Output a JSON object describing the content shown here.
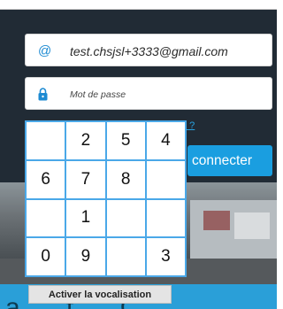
{
  "login": {
    "email_icon": "@",
    "email_value": "test.chsjsl+3333@gmail.com",
    "password_icon": "lock-icon",
    "password_placeholder": "Mot de passe",
    "forgot_link": "à ?",
    "connect_button": "connecter"
  },
  "keypad": {
    "keys": [
      "",
      "2",
      "5",
      "4",
      "6",
      "7",
      "8",
      "",
      "",
      "1",
      "",
      "",
      "0",
      "9",
      "",
      "3"
    ]
  },
  "vocalisation_button": "Activer la vocalisation",
  "banner_text": "a       t C",
  "colors": {
    "panel_bg": "#212b35",
    "accent": "#1a9ee0",
    "keypad_border": "#4aa8e8",
    "strip": "#2a9fd8"
  }
}
